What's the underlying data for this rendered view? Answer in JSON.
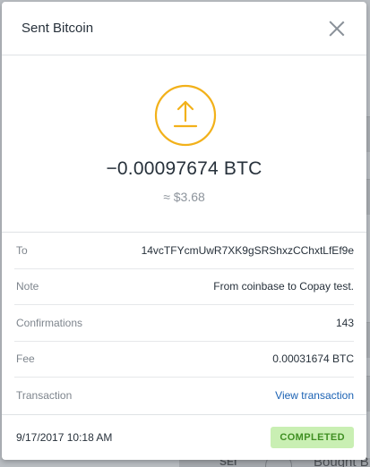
{
  "modal": {
    "title": "Sent Bitcoin",
    "close_icon": "close-icon"
  },
  "summary": {
    "icon": "upload-arrow-icon",
    "icon_color": "#f2b11a",
    "amount_btc": "−0.00097674 BTC",
    "amount_usd": "≈ $3.68"
  },
  "details": [
    {
      "label": "To",
      "value": "14vcTFYcmUwR7XK9gSRShxzCChxtLfEf9e",
      "link": false
    },
    {
      "label": "Note",
      "value": "From coinbase to Copay test.",
      "link": false
    },
    {
      "label": "Confirmations",
      "value": "143",
      "link": false
    },
    {
      "label": "Fee",
      "value": "0.00031674 BTC",
      "link": false
    },
    {
      "label": "Transaction",
      "value": "View transaction",
      "link": true
    }
  ],
  "footer": {
    "date": "9/17/2017 10:18 AM",
    "status": "COMPLETED",
    "status_bg": "#c9efb3",
    "status_color": "#3f8f22"
  },
  "background": {
    "date_label": "SEI",
    "item_text": "Bought B"
  }
}
